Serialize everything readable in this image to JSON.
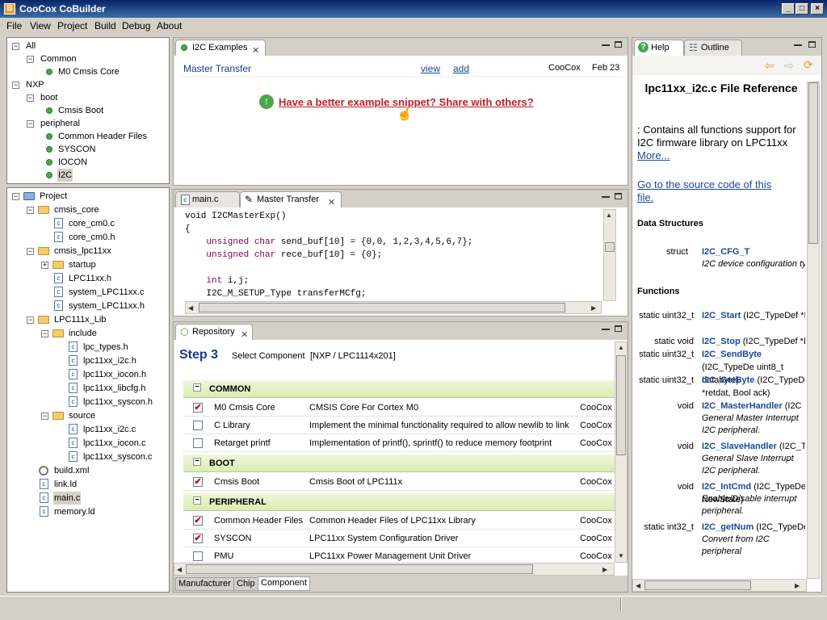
{
  "app": {
    "title": "CooCox CoBuilder",
    "icon": "coobuilder-icon"
  },
  "window_controls": {
    "minimize": "_",
    "maximize": "□",
    "close": "×"
  },
  "menu": [
    "File",
    "View",
    "Project",
    "Build",
    "Debug",
    "About"
  ],
  "components_tree": [
    {
      "label": "All",
      "level": 0,
      "exp": "−"
    },
    {
      "label": "Common",
      "level": 1,
      "exp": "−"
    },
    {
      "label": "M0 Cmsis Core",
      "level": 2,
      "dot": true
    },
    {
      "label": "NXP",
      "level": 0,
      "exp": "−"
    },
    {
      "label": "boot",
      "level": 1,
      "exp": "−"
    },
    {
      "label": "Cmsis Boot",
      "level": 2,
      "dot": true
    },
    {
      "label": "peripheral",
      "level": 1,
      "exp": "−"
    },
    {
      "label": "Common Header Files",
      "level": 2,
      "dot": true
    },
    {
      "label": "SYSCON",
      "level": 2,
      "dot": true
    },
    {
      "label": "IOCON",
      "level": 2,
      "dot": true
    },
    {
      "label": "I2C",
      "level": 2,
      "dot": true,
      "selected": true
    }
  ],
  "project_tree": [
    {
      "label": "Project",
      "level": 0,
      "exp": "−",
      "icon": "project"
    },
    {
      "label": "cmsis_core",
      "level": 1,
      "exp": "−",
      "icon": "folder"
    },
    {
      "label": "core_cm0.c",
      "level": 2,
      "icon": "file"
    },
    {
      "label": "core_cm0.h",
      "level": 2,
      "icon": "file"
    },
    {
      "label": "cmsis_lpc11xx",
      "level": 1,
      "exp": "−",
      "icon": "folder"
    },
    {
      "label": "startup",
      "level": 2,
      "exp": "+",
      "icon": "folder"
    },
    {
      "label": "LPC11xx.h",
      "level": 2,
      "icon": "file"
    },
    {
      "label": "system_LPC11xx.c",
      "level": 2,
      "icon": "file"
    },
    {
      "label": "system_LPC11xx.h",
      "level": 2,
      "icon": "file"
    },
    {
      "label": "LPC111x_Lib",
      "level": 1,
      "exp": "−",
      "icon": "folder"
    },
    {
      "label": "include",
      "level": 2,
      "exp": "−",
      "icon": "folder"
    },
    {
      "label": "lpc_types.h",
      "level": 3,
      "icon": "file"
    },
    {
      "label": "lpc11xx_i2c.h",
      "level": 3,
      "icon": "file"
    },
    {
      "label": "lpc11xx_iocon.h",
      "level": 3,
      "icon": "file"
    },
    {
      "label": "lpc11xx_libcfg.h",
      "level": 3,
      "icon": "file"
    },
    {
      "label": "lpc11xx_syscon.h",
      "level": 3,
      "icon": "file"
    },
    {
      "label": "source",
      "level": 2,
      "exp": "−",
      "icon": "folder"
    },
    {
      "label": "lpc11xx_i2c.c",
      "level": 3,
      "icon": "file"
    },
    {
      "label": "lpc11xx_iocon.c",
      "level": 3,
      "icon": "file"
    },
    {
      "label": "lpc11xx_syscon.c",
      "level": 3,
      "icon": "file"
    },
    {
      "label": "build.xml",
      "level": 1,
      "icon": "gear"
    },
    {
      "label": "link.ld",
      "level": 1,
      "icon": "file"
    },
    {
      "label": "main.c",
      "level": 1,
      "icon": "file",
      "selected": true
    },
    {
      "label": "memory.ld",
      "level": 1,
      "icon": "file"
    }
  ],
  "examples": {
    "tab": "I2C Examples",
    "row": {
      "name": "Master Transfer",
      "view": "view",
      "add": "add",
      "author": "CooCox",
      "date": "Feb 23"
    },
    "share": "Have a better example snippet? Share with others?"
  },
  "editor": {
    "tabs": [
      "main.c",
      "Master Transfer"
    ],
    "lines": [
      [
        {
          "t": "void I2CMasterExp()"
        }
      ],
      [
        {
          "t": "{"
        }
      ],
      [
        {
          "t": "    "
        },
        {
          "t": "unsigned char",
          "k": 1
        },
        {
          "t": " send_buf[10] = {0,0, 1,2,3,4,5,6,7};"
        }
      ],
      [
        {
          "t": "    "
        },
        {
          "t": "unsigned char",
          "k": 1
        },
        {
          "t": " rece_buf[10] = {0};"
        }
      ],
      [
        {
          "t": ""
        }
      ],
      [
        {
          "t": "    "
        },
        {
          "t": "int",
          "k": 1
        },
        {
          "t": " i,j;"
        }
      ],
      [
        {
          "t": "    I2C_M_SETUP_Type transferMCfg;"
        }
      ]
    ]
  },
  "repository": {
    "tab": "Repository",
    "step": "Step 3",
    "step_label": "Select Component",
    "device": "[NXP / LPC1114x201]",
    "categories": [
      {
        "name": "COMMON",
        "rows": [
          {
            "name": "M0 Cmsis Core",
            "desc": "CMSIS Core For Cortex M0",
            "author": "CooCox",
            "checked": true
          },
          {
            "name": "C Library",
            "desc": "Implement the minimal functionality required to allow newlib to link",
            "author": "CooCox",
            "checked": false
          },
          {
            "name": "Retarget printf",
            "desc": "Implementation of printf(), sprintf() to reduce memory footprint",
            "author": "CooCox",
            "checked": false
          }
        ]
      },
      {
        "name": "BOOT",
        "rows": [
          {
            "name": "Cmsis Boot",
            "desc": "Cmsis Boot of LPC111x",
            "author": "CooCox",
            "checked": true
          }
        ]
      },
      {
        "name": "PERIPHERAL",
        "rows": [
          {
            "name": "Common Header Files",
            "desc": "Common Header Files of LPC11xx Library",
            "author": "CooCox",
            "checked": true
          },
          {
            "name": "SYSCON",
            "desc": "LPC11xx System Configuration Driver",
            "author": "CooCox",
            "checked": true
          },
          {
            "name": "PMU",
            "desc": "LPC11xx Power Management Unit Driver",
            "author": "CooCox",
            "checked": false
          }
        ]
      }
    ],
    "bottom_tabs": [
      "Manufacturer",
      "Chip",
      "Component"
    ]
  },
  "help": {
    "tabs": [
      "Help",
      "Outline"
    ],
    "title": "lpc11xx_i2c.c File Reference",
    "intro": ": Contains all functions support for I2C firmware library on LPC11xx",
    "more": "More...",
    "source_link": "Go to the source code of this file.",
    "ds_header": "Data Structures",
    "struct_kw": "struct",
    "struct_name": "I2C_CFG_T",
    "struct_desc": "I2C device configuration type.",
    "fn_header": "Functions",
    "functions": [
      {
        "ret": "static uint32_t",
        "name": "I2C_Start",
        "args": "(I2C_TypeDef *I",
        "desc": ""
      },
      {
        "ret": "static void",
        "name": "I2C_Stop",
        "args": "(I2C_TypeDef *I",
        "desc": ""
      },
      {
        "ret": "static uint32_t",
        "name": "I2C_SendByte",
        "args": "(I2C_TypeDe uint8_t databyte)",
        "desc": ""
      },
      {
        "ret": "static uint32_t",
        "name": "I2C_GetByte",
        "args": "(I2C_TypeDe *retdat, Bool ack)",
        "desc": ""
      },
      {
        "ret": "void",
        "name": "I2C_MasterHandler",
        "args": "(I2C",
        "desc": "General Master Interrupt I2C peripheral."
      },
      {
        "ret": "void",
        "name": "I2C_SlaveHandler",
        "args": "(I2C_T",
        "desc": "General Slave Interrupt I2C peripheral."
      },
      {
        "ret": "void",
        "name": "I2C_IntCmd",
        "args": "(I2C_TypeDe NewState)",
        "desc": "Enable/Disable interrupt peripheral."
      },
      {
        "ret": "static int32_t",
        "name": "I2C_getNum",
        "args": "(I2C_TypeDe",
        "desc": "Convert from I2C peripheral"
      }
    ]
  }
}
